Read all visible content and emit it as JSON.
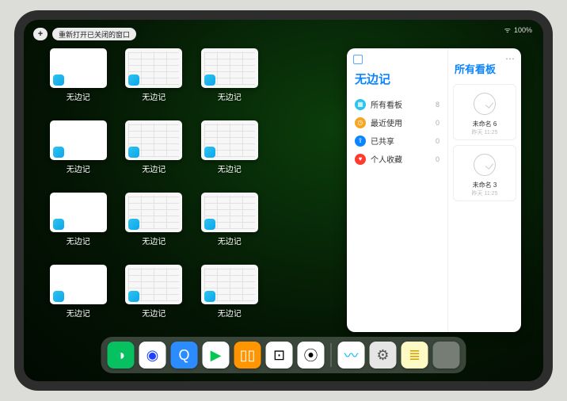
{
  "status": {
    "battery": "100%",
    "signal": "ᯤ"
  },
  "topbar": {
    "plus": "+",
    "reopen": "重新打开已关闭的窗口"
  },
  "windows": [
    {
      "label": "无边记",
      "style": "blank"
    },
    {
      "label": "无边记",
      "style": "grid-style"
    },
    {
      "label": "无边记",
      "style": "grid-style"
    },
    null,
    {
      "label": "无边记",
      "style": "blank"
    },
    {
      "label": "无边记",
      "style": "grid-style"
    },
    {
      "label": "无边记",
      "style": "grid-style"
    },
    null,
    {
      "label": "无边记",
      "style": "blank"
    },
    {
      "label": "无边记",
      "style": "grid-style"
    },
    {
      "label": "无边记",
      "style": "grid-style"
    },
    null,
    {
      "label": "无边记",
      "style": "blank"
    },
    {
      "label": "无边记",
      "style": "grid-style"
    },
    {
      "label": "无边记",
      "style": "grid-style"
    }
  ],
  "panel": {
    "title": "无边记",
    "right_title": "所有看板",
    "menu": "⋯",
    "rows": [
      {
        "icon_bg": "#2cc4ef",
        "icon": "▦",
        "label": "所有看板",
        "count": "8"
      },
      {
        "icon_bg": "#f6a623",
        "icon": "◷",
        "label": "最近使用",
        "count": "0"
      },
      {
        "icon_bg": "#0b84ff",
        "icon": "⇪",
        "label": "已共享",
        "count": "0"
      },
      {
        "icon_bg": "#ff3b30",
        "icon": "♥",
        "label": "个人收藏",
        "count": "0"
      }
    ],
    "boards": [
      {
        "name": "未命名 6",
        "date": "昨天 11:25"
      },
      {
        "name": "未命名 3",
        "date": "昨天 11:25"
      }
    ]
  },
  "dock": {
    "apps": [
      {
        "name": "wechat-icon",
        "bg": "#07c160",
        "g": "◑"
      },
      {
        "name": "tencent-video-icon",
        "bg": "#ffffff",
        "g": "◉",
        "fg": "#1e40ff"
      },
      {
        "name": "qq-browser-icon",
        "bg": "#2b8cff",
        "g": "Q"
      },
      {
        "name": "play-icon",
        "bg": "#ffffff",
        "g": "▶",
        "fg": "#00c853"
      },
      {
        "name": "books-icon",
        "bg": "#ff9500",
        "g": "▯▯",
        "fg": "#fff"
      },
      {
        "name": "dice-icon",
        "bg": "#ffffff",
        "g": "⊡",
        "fg": "#000"
      },
      {
        "name": "barcode-icon",
        "bg": "#ffffff",
        "g": "⦿",
        "fg": "#000"
      }
    ],
    "recent": [
      {
        "name": "freeform-icon",
        "bg": "#ffffff",
        "g": "〰",
        "fg": "#00b7ff"
      },
      {
        "name": "settings-icon",
        "bg": "#e5e5e5",
        "g": "⚙",
        "fg": "#555"
      },
      {
        "name": "notes-icon",
        "bg": "#fff9c4",
        "g": "≣",
        "fg": "#d4a000"
      },
      {
        "name": "cluster-icon",
        "split": true
      }
    ]
  }
}
